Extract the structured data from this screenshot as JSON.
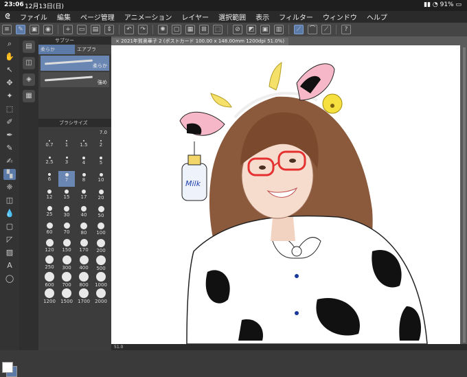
{
  "status": {
    "time": "23:06",
    "date": "12月13日(日)",
    "battery": "91%"
  },
  "menu": [
    "ファイル",
    "編集",
    "ページ管理",
    "アニメーション",
    "レイヤー",
    "選択範囲",
    "表示",
    "フィルター",
    "ウィンドウ",
    "ヘルプ"
  ],
  "tool_panel": {
    "tab_label": "サブツー",
    "subtabs": [
      "柔らか",
      "エアブラ"
    ],
    "brushes": [
      {
        "name": "柔らか"
      },
      {
        "name": "強め"
      }
    ]
  },
  "brush_size": {
    "header": "ブラシサイズ",
    "value": "7.0",
    "sizes": [
      "0.7",
      "1",
      "1.5",
      "2",
      "2.5",
      "3",
      "4",
      "5",
      "6",
      "7",
      "8",
      "10",
      "12",
      "15",
      "17",
      "20",
      "25",
      "30",
      "40",
      "50",
      "60",
      "70",
      "80",
      "100",
      "120",
      "150",
      "170",
      "200",
      "250",
      "300",
      "400",
      "500",
      "600",
      "700",
      "800",
      "1000",
      "1200",
      "1500",
      "1700",
      "2000"
    ],
    "selected": "7"
  },
  "document": {
    "tab_title": "2021年賀奥華子 2 (ポストカード 100.00 x 148.00mm 1200dpi 51.0%)",
    "zoom": "51.0"
  },
  "artwork": {
    "bottle_label": "Milk"
  },
  "colors": {
    "accent": "#5b7aa8",
    "background": "#3a3a3a",
    "canvas": "#ffffff"
  }
}
